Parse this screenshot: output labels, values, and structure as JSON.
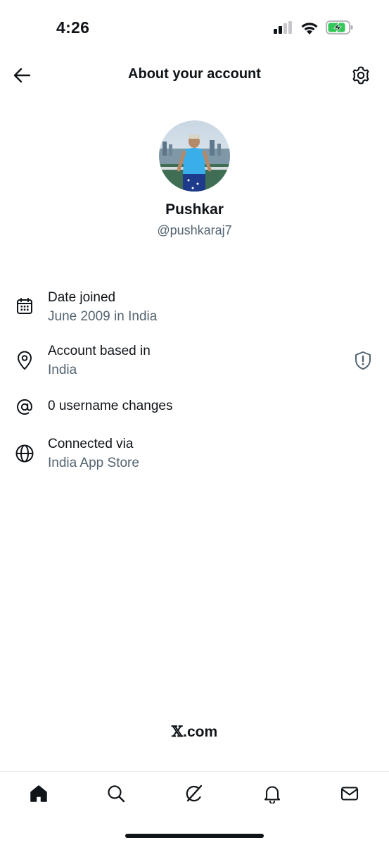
{
  "status_bar": {
    "time": "4:26"
  },
  "header": {
    "title": "About your account"
  },
  "profile": {
    "name": "Pushkar",
    "handle": "@pushkaraj7"
  },
  "info": {
    "date_joined": {
      "title": "Date joined",
      "value": "June 2009 in India",
      "icon": "calendar-icon"
    },
    "account_based": {
      "title": "Account based in",
      "value": "India",
      "icon": "location-pin-icon",
      "badge_icon": "shield-alert-icon"
    },
    "username_changes": {
      "title": "0 username changes",
      "icon": "at-sign-icon"
    },
    "connected_via": {
      "title": "Connected via",
      "value": "India App Store",
      "icon": "globe-icon"
    }
  },
  "footer": {
    "brand_x": "𝕏",
    "brand_rest": ".com"
  },
  "bottom_nav": {
    "items": [
      "home-icon",
      "search-icon",
      "grok-icon",
      "bell-icon",
      "mail-icon"
    ]
  },
  "colors": {
    "text_primary": "#0f1419",
    "text_secondary": "#536471",
    "battery_green": "#34c759"
  }
}
